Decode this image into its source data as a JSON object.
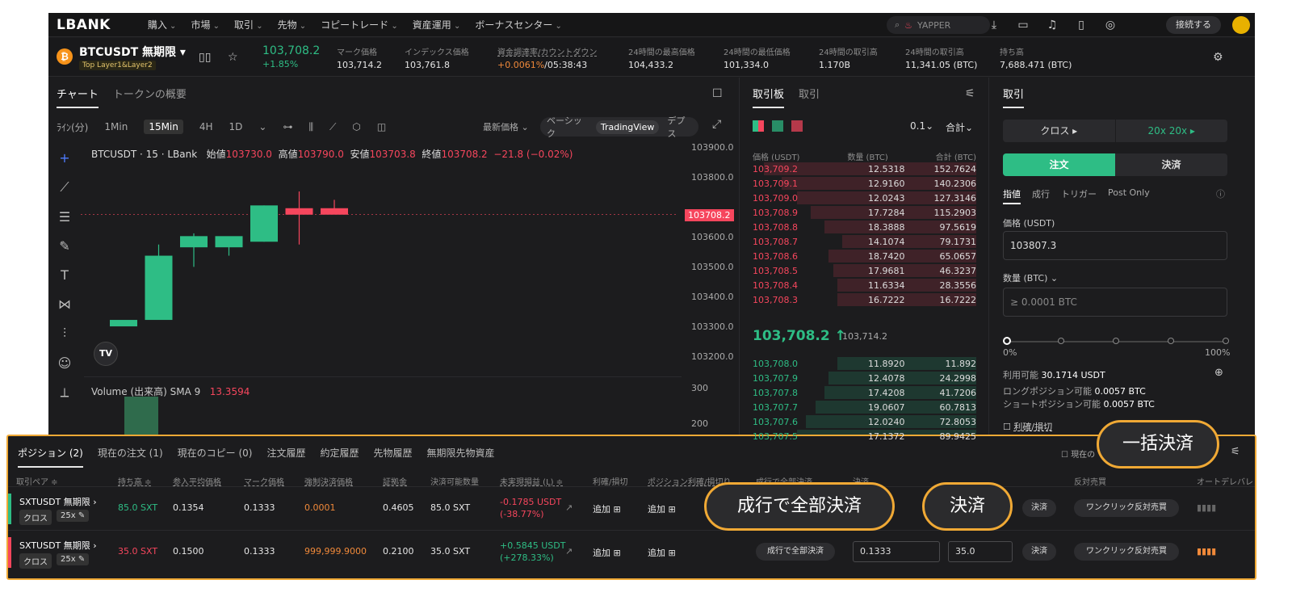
{
  "nav": {
    "logo": "LBANK",
    "items": [
      "購入",
      "市場",
      "取引",
      "先物",
      "コピートレード",
      "資産運用",
      "ボーナスセンター"
    ],
    "search_placeholder": "YAPPER",
    "connect_label": "接続する"
  },
  "ticker": {
    "pair": "BTCUSDT 無期限",
    "tag": "Top   Layer1&Layer2",
    "last_price": "103,708.2",
    "change": "+1.85%",
    "stats": [
      {
        "label": "マーク価格",
        "value": "103,714.2"
      },
      {
        "label": "インデックス価格",
        "value": "103,761.8"
      },
      {
        "label": "資金調達率/カウントダウン",
        "value_a": "+0.0061%",
        "value_b": "/05:38:43"
      },
      {
        "label": "24時間の最高価格",
        "value": "104,433.2"
      },
      {
        "label": "24時間の最低価格",
        "value": "101,334.0"
      },
      {
        "label": "24時間の取引高",
        "value": "1.170B"
      },
      {
        "label": "24時間の取引高",
        "value": "11,341.05 (BTC)"
      },
      {
        "label": "持ち高",
        "value": "7,688.471 (BTC)"
      }
    ]
  },
  "chart": {
    "tabs": [
      "チャート",
      "トークンの概要"
    ],
    "timeframes": [
      "ﾗｲﾝ(分)",
      "1Min",
      "15Min",
      "4H",
      "1D"
    ],
    "active_timeframe": "15Min",
    "price_mode": "最新価格",
    "views": [
      "ベーシック",
      "TradingView",
      "デプス"
    ],
    "active_view": "TradingView",
    "ohlc_title": "BTCUSDT · 15 · LBank",
    "open_label": "始値",
    "open": "103730.0",
    "high_label": "高値",
    "high": "103790.0",
    "low_label": "安値",
    "low": "103703.8",
    "close_label": "終値",
    "close": "103708.2",
    "change": "−21.8 (−0.02%)",
    "price_axis": [
      "103900.0",
      "103800.0",
      "103600.0",
      "103500.0",
      "103400.0",
      "103300.0",
      "103200.0"
    ],
    "current_price_tag": "103708.2",
    "volume_label": "Volume (出来高) SMA 9",
    "volume_value": "13.3594",
    "volume_axis": [
      "300",
      "200"
    ],
    "tv_badge": "TV"
  },
  "chart_data": {
    "type": "candlestick",
    "categories": [
      "1",
      "2",
      "3",
      "4",
      "5",
      "6",
      "7"
    ],
    "open": [
      103330,
      103330,
      103590,
      103590,
      103610,
      103730,
      103730
    ],
    "high": [
      103330,
      103600,
      103640,
      103610,
      103740,
      103790,
      103760
    ],
    "low": [
      103330,
      103380,
      103520,
      103560,
      103610,
      103600,
      103710
    ],
    "close": [
      103330,
      103560,
      103630,
      103630,
      103740,
      103720,
      103708.2
    ],
    "ylim": [
      103200,
      103900
    ]
  },
  "orderbook": {
    "tabs": [
      "取引板",
      "取引"
    ],
    "precision": "0.1",
    "mode": "合計",
    "headers": [
      "価格 (USDT)",
      "数量 (BTC)",
      "合計 (BTC)"
    ],
    "asks": [
      {
        "p": "103,709.2",
        "q": "12.5318",
        "t": "152.7624",
        "w": 0.95
      },
      {
        "p": "103,709.1",
        "q": "12.9160",
        "t": "140.2306",
        "w": 0.87
      },
      {
        "p": "103,709.0",
        "q": "12.0243",
        "t": "127.3146",
        "w": 0.8
      },
      {
        "p": "103,708.9",
        "q": "17.7284",
        "t": "115.2903",
        "w": 0.74
      },
      {
        "p": "103,708.8",
        "q": "18.3888",
        "t": "97.5619",
        "w": 0.68
      },
      {
        "p": "103,708.7",
        "q": "14.1074",
        "t": "79.1731",
        "w": 0.6
      },
      {
        "p": "103,708.6",
        "q": "18.7420",
        "t": "65.0657",
        "w": 0.66
      },
      {
        "p": "103,708.5",
        "q": "17.9681",
        "t": "46.3237",
        "w": 0.64
      },
      {
        "p": "103,708.4",
        "q": "11.6334",
        "t": "28.3556",
        "w": 0.62
      },
      {
        "p": "103,708.3",
        "q": "16.7222",
        "t": "16.7222",
        "w": 0.62
      }
    ],
    "mid_price": "103,708.2 ↑",
    "mid_mark": "103,714.2",
    "bids": [
      {
        "p": "103,708.0",
        "q": "11.8920",
        "t": "11.892",
        "w": 0.62
      },
      {
        "p": "103,707.9",
        "q": "12.4078",
        "t": "24.2998",
        "w": 0.66
      },
      {
        "p": "103,707.8",
        "q": "17.4208",
        "t": "41.7206",
        "w": 0.68
      },
      {
        "p": "103,707.7",
        "q": "19.0607",
        "t": "60.7813",
        "w": 0.72
      },
      {
        "p": "103,707.6",
        "q": "12.0240",
        "t": "72.8053",
        "w": 0.76
      },
      {
        "p": "103,707.5",
        "q": "17.1372",
        "t": "89.9425",
        "w": 0.8
      }
    ]
  },
  "trade": {
    "tab": "取引",
    "margin_mode": "クロス",
    "leverage": "20x  20x",
    "order_tab": "注文",
    "close_tab": "決済",
    "types": [
      "指値",
      "成行",
      "トリガー",
      "Post Only"
    ],
    "price_label": "価格 (USDT)",
    "price_value": "103807.3",
    "qty_label": "数量 (BTC)",
    "qty_placeholder": "≥ 0.0001 BTC",
    "slider_min": "0%",
    "slider_max": "100%",
    "available_label": "利用可能",
    "available_value": "30.1714 USDT",
    "long_label": "ロングポジション可能",
    "long_value": "0.0057 BTC",
    "short_label": "ショートポジション可能",
    "short_value": "0.0057 BTC",
    "tpsl": "利確/損切"
  },
  "positions": {
    "tabs": [
      "ポジション (2)",
      "現在の注文 (1)",
      "現在のコピー (0)",
      "注文履歴",
      "約定履歴",
      "先物履歴",
      "無期限先物資産"
    ],
    "hide_other": "現在の",
    "headers": [
      "取引ペア ≑",
      "持ち高 ≑",
      "参入平均価格",
      "マーク価格",
      "強制決済価格",
      "証拠金",
      "決済可能数量",
      "未実現損益 (L) ≑",
      "利確/損切",
      "ポジション利確/損切り",
      "成行で全部決済",
      "決済",
      "反対売買",
      "オートデレバレ"
    ],
    "rows": [
      {
        "pair": "SXTUSDT 無期限",
        "mode": "クロス",
        "lev": "25x",
        "size": "85.0 SXT",
        "entry": "0.1354",
        "mark": "0.1333",
        "liq": "0.0001",
        "margin": "0.4605",
        "closable": "85.0 SXT",
        "pnl": "-0.1785 USDT",
        "pnl_pct": "(-38.77%)",
        "tpsl": "追加",
        "pos_tpsl": "追加",
        "market_close": "成行で全部決済",
        "close_price": "",
        "close_qty": "",
        "close": "決済",
        "reverse": "ワンクリック反対売買",
        "side": "long"
      },
      {
        "pair": "SXTUSDT 無期限",
        "mode": "クロス",
        "lev": "25x",
        "size": "35.0 SXT",
        "entry": "0.1500",
        "mark": "0.1333",
        "liq": "999,999.9000",
        "margin": "0.2100",
        "closable": "35.0 SXT",
        "pnl": "+0.5845 USDT",
        "pnl_pct": "(+278.33%)",
        "tpsl": "追加",
        "pos_tpsl": "追加",
        "market_close": "成行で全部決済",
        "close_price": "0.1333",
        "close_qty": "35.0",
        "close": "決済",
        "reverse": "ワンクリック反対売買",
        "side": "short"
      }
    ]
  },
  "callouts": {
    "close_all": "一括決済",
    "market_close_all": "成行で全部決済",
    "close": "決済"
  },
  "colors": {
    "up": "#2ebd85",
    "down": "#f6465d",
    "accent": "#f0a935",
    "bg": "#1c1c1e"
  }
}
